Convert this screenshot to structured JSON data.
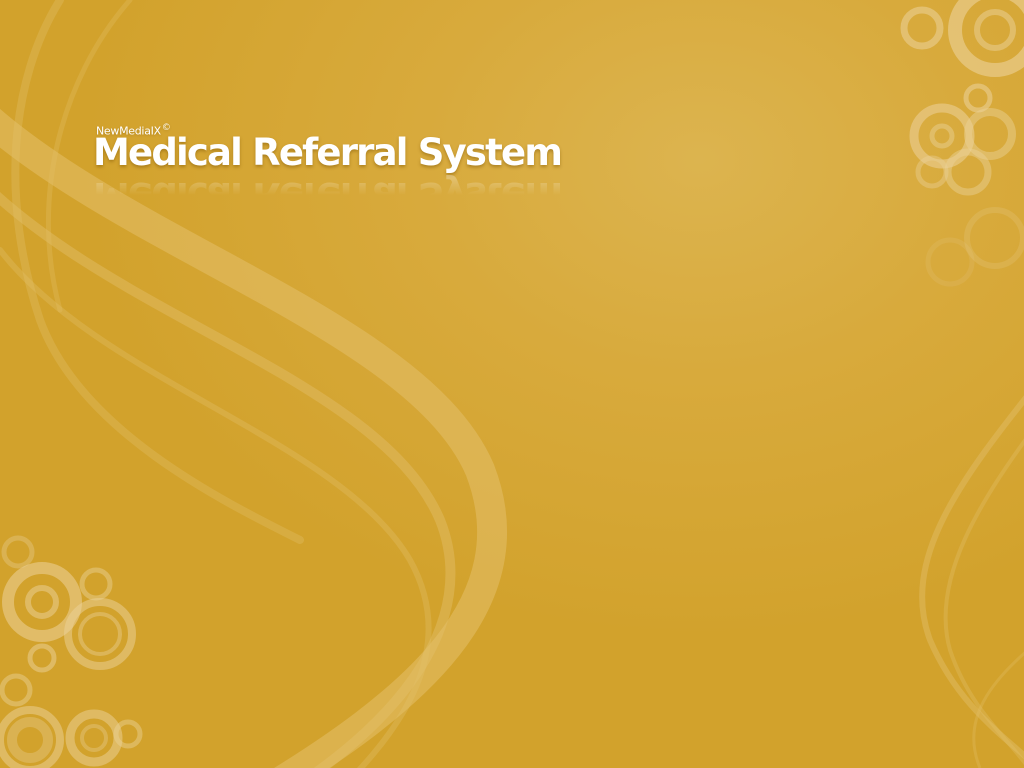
{
  "splash": {
    "brand": "NewMediaIX",
    "copyright_symbol": "©",
    "title": "Medical Referral System"
  },
  "theme": {
    "background": "#d4a430",
    "accent_light": "#e6c57c",
    "text": "#ffffff"
  }
}
